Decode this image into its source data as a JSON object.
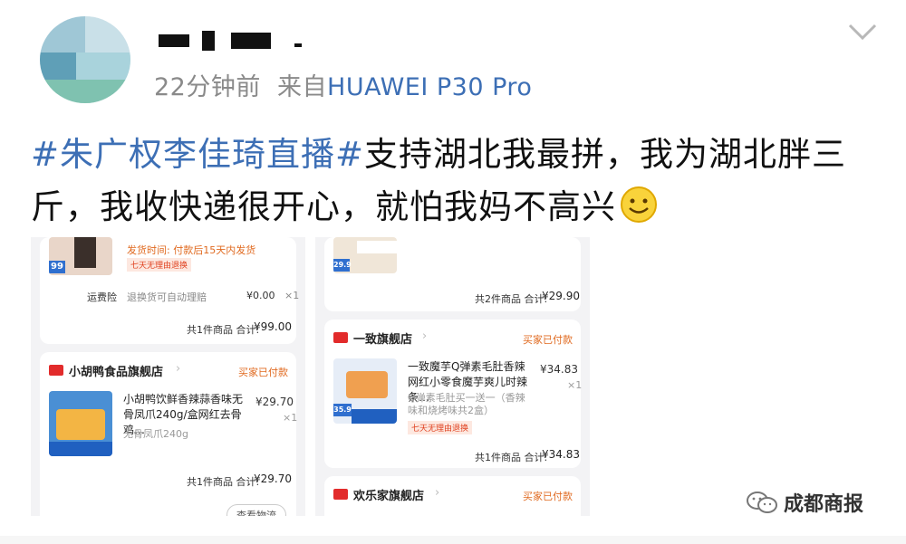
{
  "post": {
    "time_ago": "22分钟前",
    "via_prefix": "来自",
    "device": "HUAWEI P30 Pro",
    "hashtag": "#朱广权李佳琦直播#",
    "body": "支持湖北我最拼，我为湖北胖三斤，我收快递很开心，就怕我妈不高兴",
    "icons": {
      "chevron": "chevron-down-icon",
      "emoji": "smile-emoji-icon",
      "avatar": "avatar"
    }
  },
  "orders_left": {
    "order1": {
      "shipping_time": "发货时间: 付款后15天内发货",
      "return_badge": "七天无理由退换",
      "thumb_badge": "99",
      "insurance_label": "运费险",
      "insurance_desc": "退换货可自动理赔",
      "insurance_price": "¥0.00",
      "insurance_qty": "×1",
      "summary_prefix": "共1件商品 合计:",
      "summary_total": "¥99.00"
    },
    "order2": {
      "store": "小胡鸭食品旗舰店",
      "status": "买家已付款",
      "title": "小胡鸭饮鲜香辣蒜香味无骨凤爪240g/盒网红去骨鸡…",
      "spec": "无骨凤爪240g",
      "price": "¥29.70",
      "qty": "×1",
      "summary_prefix": "共1件商品 合计:",
      "summary_total": "¥29.70",
      "button": "查看物流"
    }
  },
  "orders_right": {
    "order1": {
      "thumb_badge": "29.9",
      "summary_prefix": "共2件商品 合计:",
      "summary_total": "¥29.90"
    },
    "order2": {
      "store": "一致旗舰店",
      "status": "买家已付款",
      "title": "一致魔芋Q弹素毛肚香辣网红小零食魔芋爽儿时辣条…",
      "spec": "Q弹素毛肚买一送一（香辣味和烧烤味共2盒）",
      "price": "¥34.83",
      "qty": "×1",
      "return_badge": "七天无理由退换",
      "thumb_badge": "35.9",
      "summary_prefix": "共1件商品 合计:",
      "summary_total": "¥34.83"
    },
    "order3": {
      "store": "欢乐家旗舰店",
      "status": "买家已付款"
    }
  },
  "watermark": {
    "text": "成都商报",
    "icon": "wechat-icon"
  }
}
